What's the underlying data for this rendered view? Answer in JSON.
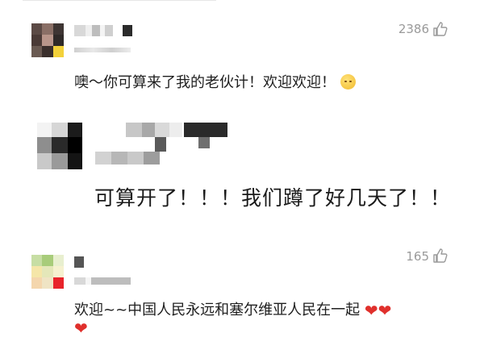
{
  "comments": [
    {
      "likes": "2386",
      "text": "噢～你可算来了我的老伙计！欢迎欢迎！",
      "emoji_icon": "face-holding-back-tears-icon"
    },
    {
      "text": "可算开了！！！我们蹲了好几天了！！"
    },
    {
      "likes": "165",
      "text_line1": "欢迎~~中国人民永远和塞尔维亚人民在一起",
      "heart": "❤",
      "heart_color": "#e0302c"
    }
  ],
  "colors": {
    "likes_gray": "#9a9a9a"
  },
  "icons": {
    "like": "thumbs-up-outline-icon"
  }
}
